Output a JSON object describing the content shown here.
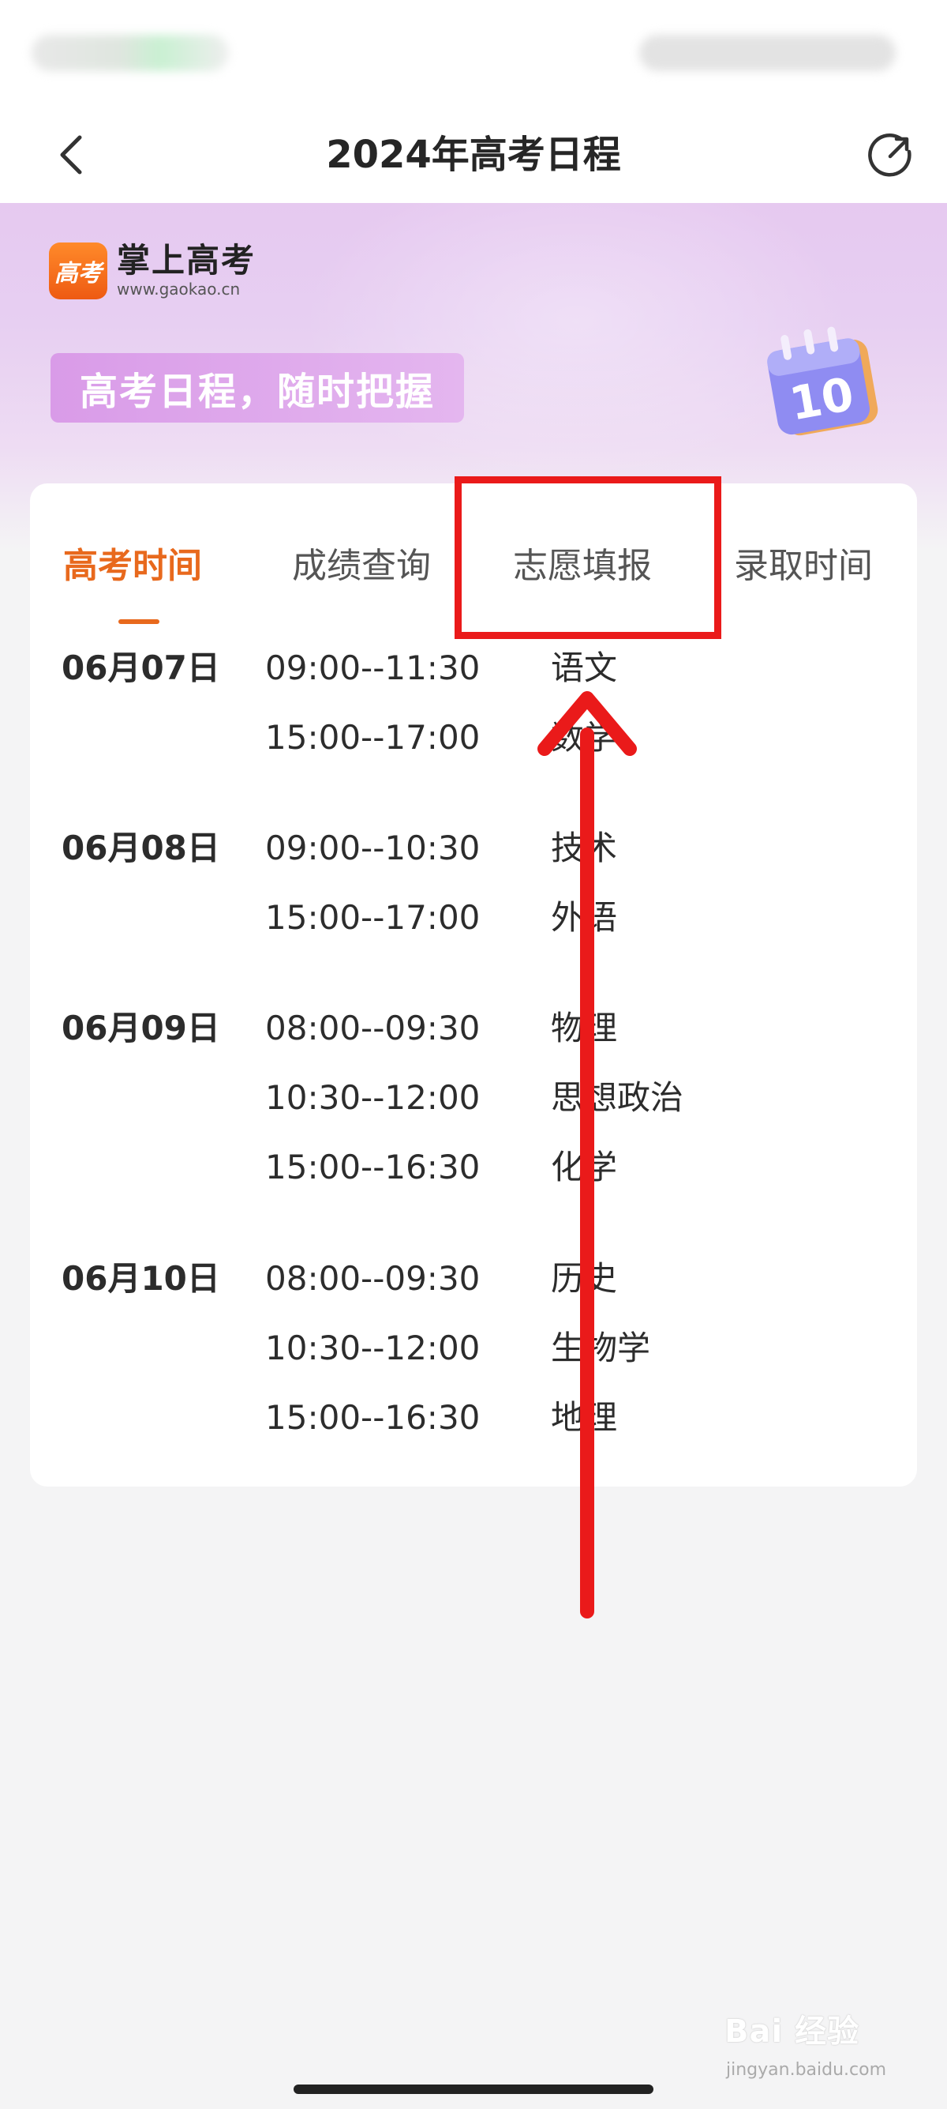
{
  "nav": {
    "title": "2024年高考日程"
  },
  "hero": {
    "logo_mark": "高考",
    "logo_name": "掌上高考",
    "logo_url": "www.gaokao.cn",
    "slogan": "高考日程，随时把握",
    "calendar_number": "10"
  },
  "tabs": [
    {
      "label": "高考时间",
      "active": true
    },
    {
      "label": "成绩查询",
      "active": false
    },
    {
      "label": "志愿填报",
      "active": false
    },
    {
      "label": "录取时间",
      "active": false
    }
  ],
  "schedule": [
    {
      "date": "06月07日",
      "sessions": [
        {
          "time": "09:00--11:30",
          "subject": "语文"
        },
        {
          "time": "15:00--17:00",
          "subject": "数学"
        }
      ]
    },
    {
      "date": "06月08日",
      "sessions": [
        {
          "time": "09:00--10:30",
          "subject": "技术"
        },
        {
          "time": "15:00--17:00",
          "subject": "外语"
        }
      ]
    },
    {
      "date": "06月09日",
      "sessions": [
        {
          "time": "08:00--09:30",
          "subject": "物理"
        },
        {
          "time": "10:30--12:00",
          "subject": "思想政治"
        },
        {
          "time": "15:00--16:30",
          "subject": "化学"
        }
      ]
    },
    {
      "date": "06月10日",
      "sessions": [
        {
          "time": "08:00--09:30",
          "subject": "历史"
        },
        {
          "time": "10:30--12:00",
          "subject": "生物学"
        },
        {
          "time": "15:00--16:30",
          "subject": "地理"
        }
      ]
    }
  ],
  "watermark": {
    "text": "Bai 经验",
    "sub": "jingyan.baidu.com"
  },
  "colors": {
    "accent": "#e8691d",
    "annotation": "#ea1a1a",
    "hero": "#e6c9f0",
    "slogan_bg": "#d99be8"
  }
}
